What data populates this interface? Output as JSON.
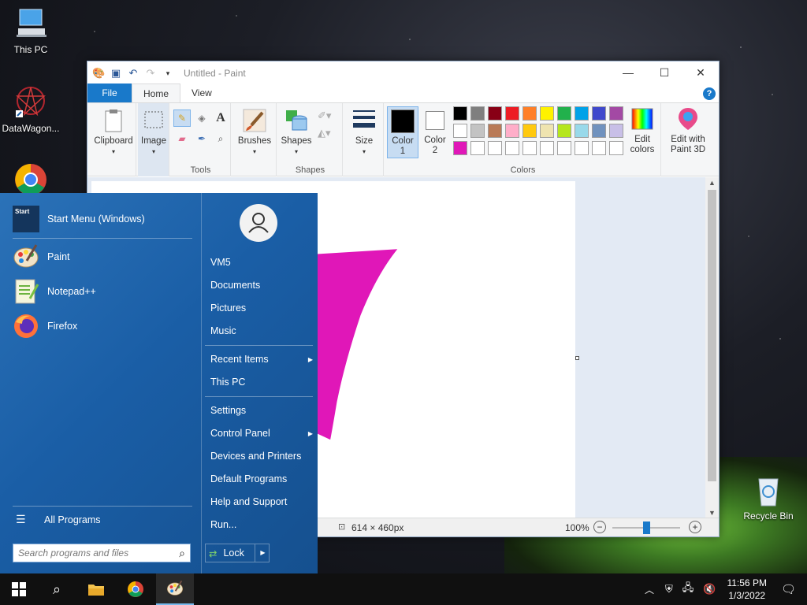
{
  "desktop": {
    "icons": [
      {
        "label": "This PC"
      },
      {
        "label": "DataWagon..."
      },
      {
        "label": "Recycle Bin"
      }
    ]
  },
  "paint": {
    "title": "Untitled - Paint",
    "tabs": [
      "File",
      "Home",
      "View"
    ],
    "help_label": "?",
    "groups": {
      "clipboard": "Clipboard",
      "image": "Image",
      "tools": "Tools",
      "brushes": "Brushes",
      "shapes": "Shapes",
      "shapes_group": "Shapes",
      "size": "Size",
      "color1": "Color\n1",
      "color2": "Color\n2",
      "colors": "Colors",
      "edit_colors": "Edit\ncolors",
      "edit_paint3d": "Edit with\nPaint 3D"
    },
    "palette_row1": [
      "#000000",
      "#7f7f7f",
      "#880015",
      "#ed1c24",
      "#ff7f27",
      "#fff200",
      "#22b14c",
      "#00a2e8",
      "#3f48cc",
      "#a349a4"
    ],
    "palette_row2": [
      "#ffffff",
      "#c3c3c3",
      "#b97a57",
      "#ffaec9",
      "#ffc90e",
      "#efe4b0",
      "#b5e61d",
      "#99d9ea",
      "#7092be",
      "#c8bfe7"
    ],
    "palette_row3": [
      "#e017b8",
      "#ffffff",
      "#ffffff",
      "#ffffff",
      "#ffffff",
      "#ffffff",
      "#ffffff",
      "#ffffff",
      "#ffffff",
      "#ffffff"
    ],
    "color1": "#000000",
    "color2": "#ffffff",
    "stroke_color": "#e017b8",
    "status": {
      "size": "614 × 460px",
      "zoom": "100%",
      "zoom_level": 0.5
    }
  },
  "start_menu": {
    "header": "Start Menu (Windows)",
    "header_icon_text": "Start",
    "pinned": [
      {
        "label": "Paint"
      },
      {
        "label": "Notepad++"
      },
      {
        "label": "Firefox"
      }
    ],
    "all_programs": "All Programs",
    "search_placeholder": "Search programs and files",
    "right": {
      "user": "VM5",
      "group1": [
        "Documents",
        "Pictures",
        "Music"
      ],
      "group2": [
        "Recent Items",
        "This PC"
      ],
      "group3": [
        "Settings",
        "Control Panel",
        "Devices and Printers",
        "Default Programs",
        "Help and Support",
        "Run..."
      ]
    },
    "lock": "Lock"
  },
  "taskbar": {
    "time": "11:56 PM",
    "date": "1/3/2022"
  }
}
